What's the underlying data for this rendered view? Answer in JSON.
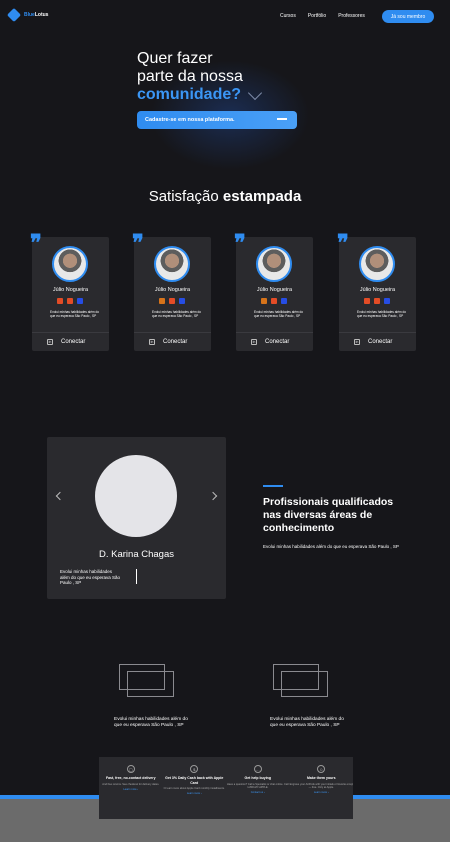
{
  "nav": {
    "logo_prefix": "Blue",
    "logo_suffix": "Lotus",
    "links": [
      "Cursos",
      "Portfólio",
      "Professores"
    ],
    "cta": "Já sou membro"
  },
  "hero": {
    "line1": "Quer fazer",
    "line2": "parte da nossa",
    "highlight": "comunidade?",
    "cta": "Cadastre-se em nossa plataforma."
  },
  "satisfaction": {
    "title_regular": "Satisfação",
    "title_bold": "estampada"
  },
  "testimonials": [
    {
      "name": "Júlio Nogueira",
      "desc": "Evolui minhas habilidades além do que eu esperava São Paulo , SP",
      "action": "Conectar",
      "techs": [
        "#e34c26",
        "#e34c26",
        "#264de4"
      ]
    },
    {
      "name": "Júlio Nogueira",
      "desc": "Evolui minhas habilidades além do que eu esperava São Paulo , SP",
      "action": "Conectar",
      "techs": [
        "#d6731a",
        "#e34c26",
        "#264de4"
      ]
    },
    {
      "name": "Júlio Nogueira",
      "desc": "Evolui minhas habilidades além do que eu esperava São Paulo , SP",
      "action": "Conectar",
      "techs": [
        "#d6731a",
        "#e34c26",
        "#264de4"
      ]
    },
    {
      "name": "Júlio Nogueira",
      "desc": "Evolui minhas habilidades além do que eu esperava São Paulo , SP",
      "action": "Conectar",
      "techs": [
        "#e34c26",
        "#e34c26",
        "#264de4"
      ]
    }
  ],
  "profile": {
    "name": "D. Karina Chagas",
    "desc": "Evolui minhas habilidades além do que eu esperava São Paulo , SP"
  },
  "qualified": {
    "title": "Profissionais qualificados nas diversas áreas de conhecimento",
    "desc": "Evolui minhas habilidades além do que eu esperava São Paulo , SP"
  },
  "bottom_items": [
    {
      "desc": "Evolui minhas habilidades além do que eu esperava São Paulo , SP"
    },
    {
      "desc": "Evolui minhas habilidades além do que eu esperava São Paulo , SP"
    }
  ],
  "features": [
    {
      "title": "Fast, free, no-contact delivery",
      "text": "And free returns. See checkout for delivery dates.",
      "link": "Learn more ›"
    },
    {
      "title": "Get 3% Daily Cash back with Apple Card",
      "text": "Or earn more about Apple Card monthly installments.",
      "link": "Learn more ›"
    },
    {
      "title": "Get help buying",
      "text": "Have a question? Call a Specialist or chat online. Call 1-800-MY-APPLE.",
      "link": "Contact us ›"
    },
    {
      "title": "Make them yours",
      "text": "Engrave your AirPods with your initials or favorite emoji — free. Only at Apple.",
      "link": "Learn more ›"
    }
  ],
  "colors": {
    "accent": "#2f8cf0",
    "background": "#16161a",
    "card": "#2a2a2e"
  }
}
